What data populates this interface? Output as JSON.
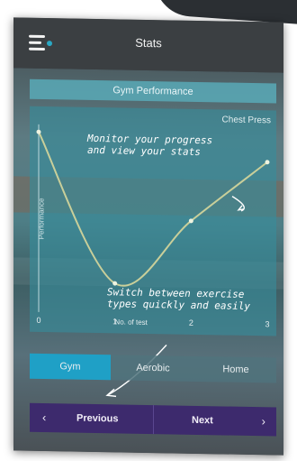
{
  "header": {
    "title": "Stats",
    "menu_icon": "hamburger-menu-icon"
  },
  "panel": {
    "header": "Gym Performance",
    "exercise": "Chest Press",
    "ylabel": "Performance"
  },
  "chart_data": {
    "type": "line",
    "x": [
      0,
      1,
      2,
      3
    ],
    "xlabel": "No. of test",
    "ylabel": "Performance",
    "tick_labels": [
      "0",
      "1",
      "2",
      "3"
    ],
    "xlim": [
      0,
      3
    ],
    "ylim": [
      0,
      10
    ],
    "series": [
      {
        "values": [
          9.6,
          1.6,
          5.0,
          8.2
        ]
      }
    ]
  },
  "annotations": {
    "progress": "Monitor your progress\nand view your stats",
    "switch": "Switch between exercise\ntypes quickly and easily"
  },
  "tabs": [
    {
      "label": "Gym",
      "active": true
    },
    {
      "label": "Aerobic",
      "active": false
    },
    {
      "label": "Home",
      "active": false
    }
  ],
  "nav": {
    "previous": "Previous",
    "next": "Next",
    "prev_icon": "chevron-left-icon",
    "next_icon": "chevron-right-icon"
  },
  "colors": {
    "accent": "#1fa0c6",
    "nav": "#3d2a6d",
    "line": "#c9cf9a"
  }
}
